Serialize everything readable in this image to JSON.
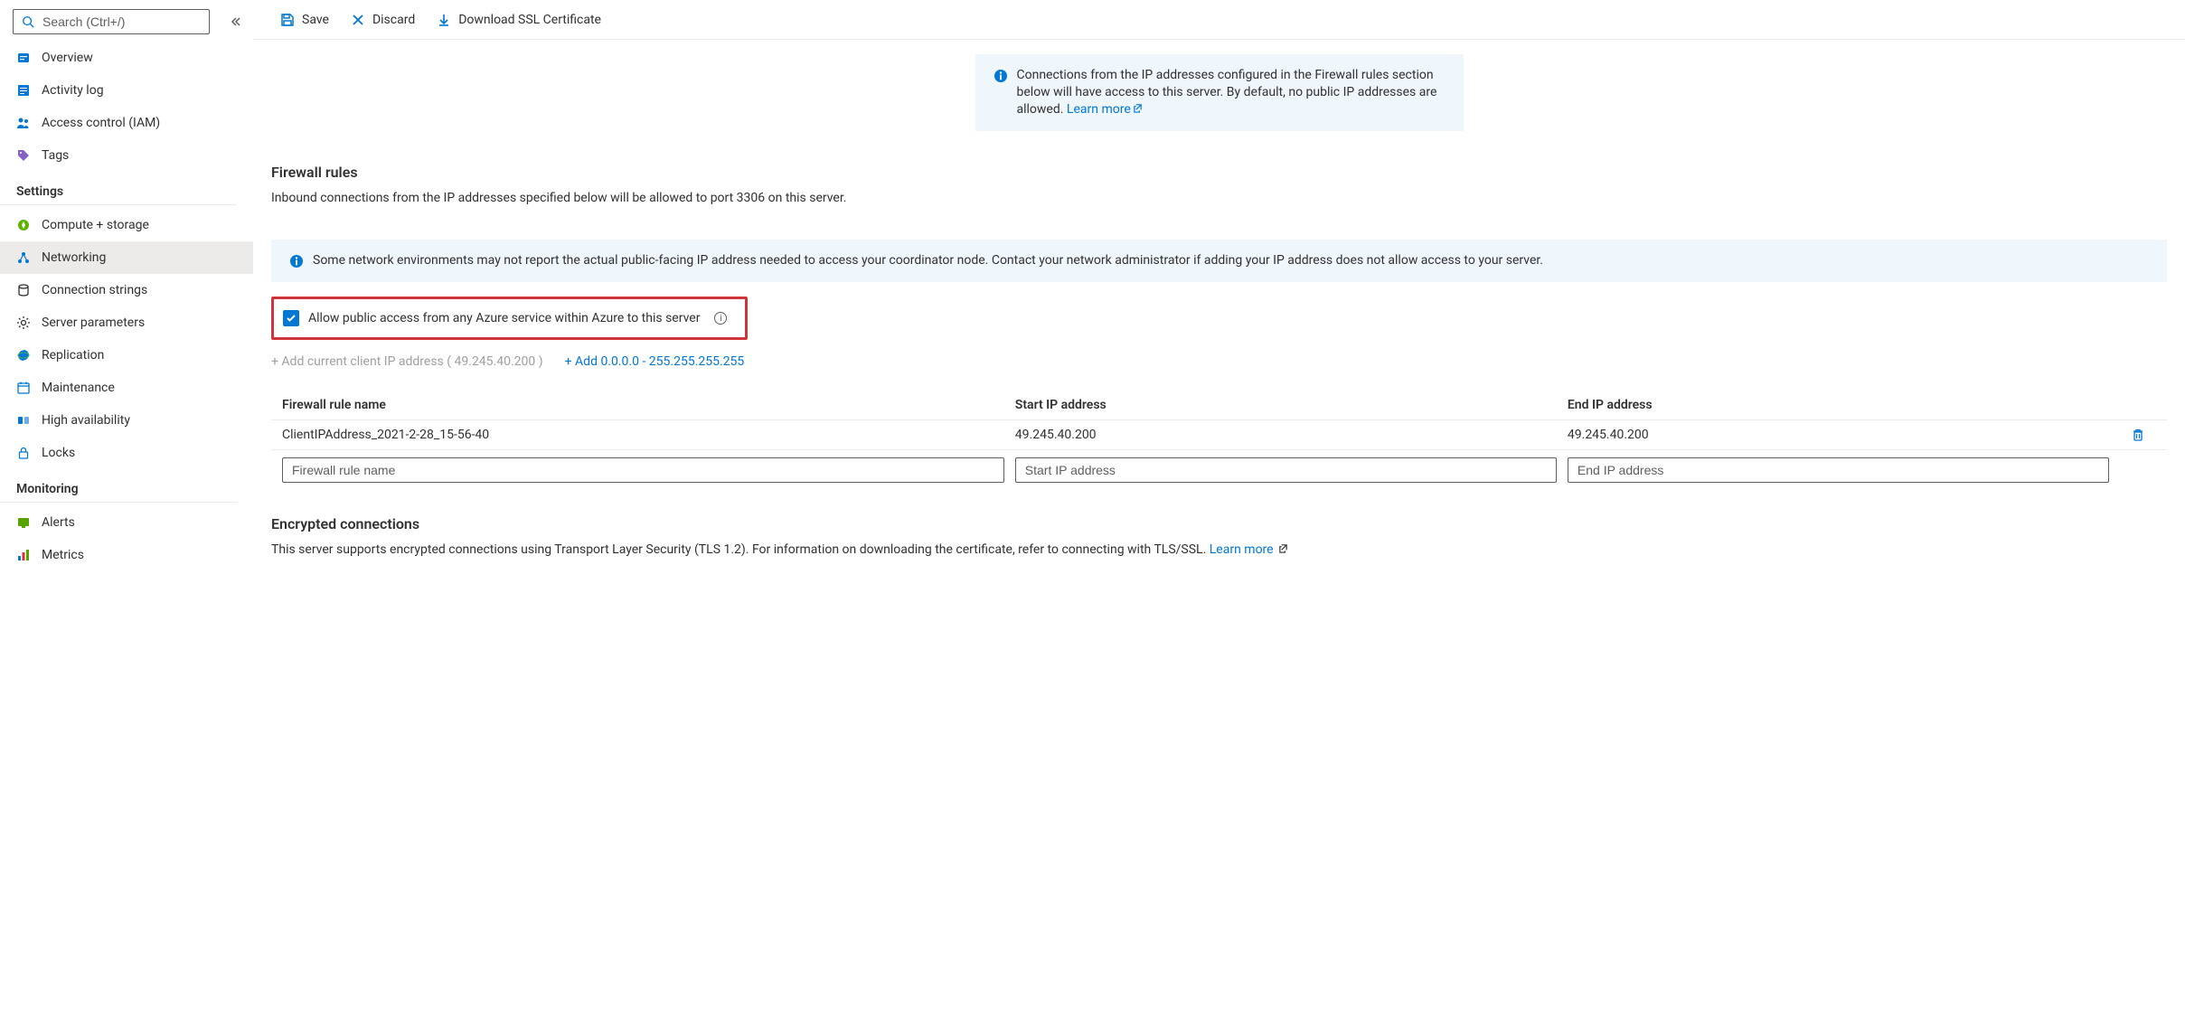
{
  "search": {
    "placeholder": "Search (Ctrl+/)"
  },
  "sidebar": {
    "top": [
      {
        "label": "Overview"
      },
      {
        "label": "Activity log"
      },
      {
        "label": "Access control (IAM)"
      },
      {
        "label": "Tags"
      }
    ],
    "sections": [
      {
        "title": "Settings",
        "items": [
          {
            "label": "Compute + storage"
          },
          {
            "label": "Networking",
            "active": true
          },
          {
            "label": "Connection strings"
          },
          {
            "label": "Server parameters"
          },
          {
            "label": "Replication"
          },
          {
            "label": "Maintenance"
          },
          {
            "label": "High availability"
          },
          {
            "label": "Locks"
          }
        ]
      },
      {
        "title": "Monitoring",
        "items": [
          {
            "label": "Alerts"
          },
          {
            "label": "Metrics"
          }
        ]
      }
    ]
  },
  "toolbar": {
    "save": "Save",
    "discard": "Discard",
    "download": "Download SSL Certificate"
  },
  "banner1": {
    "text": "Connections from the IP addresses configured in the Firewall rules section below will have access to this server. By default, no public IP addresses are allowed. ",
    "link": "Learn more"
  },
  "firewall": {
    "title": "Firewall rules",
    "desc": "Inbound connections from the IP addresses specified below will be allowed to port 3306 on this server."
  },
  "banner2": {
    "text": "Some network environments may not report the actual public-facing IP address needed to access your coordinator node. Contact your network administrator if adding your IP address does not allow access to your server."
  },
  "allowAzure": {
    "label": "Allow public access from any Azure service within Azure to this server"
  },
  "addLinks": {
    "client": "+ Add current client IP address ( 49.245.40.200 )",
    "all": "+ Add 0.0.0.0 - 255.255.255.255"
  },
  "table": {
    "headers": {
      "name": "Firewall rule name",
      "start": "Start IP address",
      "end": "End IP address"
    },
    "rows": [
      {
        "name": "ClientIPAddress_2021-2-28_15-56-40",
        "start": "49.245.40.200",
        "end": "49.245.40.200"
      }
    ],
    "placeholders": {
      "name": "Firewall rule name",
      "start": "Start IP address",
      "end": "End IP address"
    }
  },
  "encrypted": {
    "title": "Encrypted connections",
    "desc": "This server supports encrypted connections using Transport Layer Security (TLS 1.2). For information on downloading the certificate, refer to connecting with TLS/SSL. ",
    "link": "Learn more"
  }
}
